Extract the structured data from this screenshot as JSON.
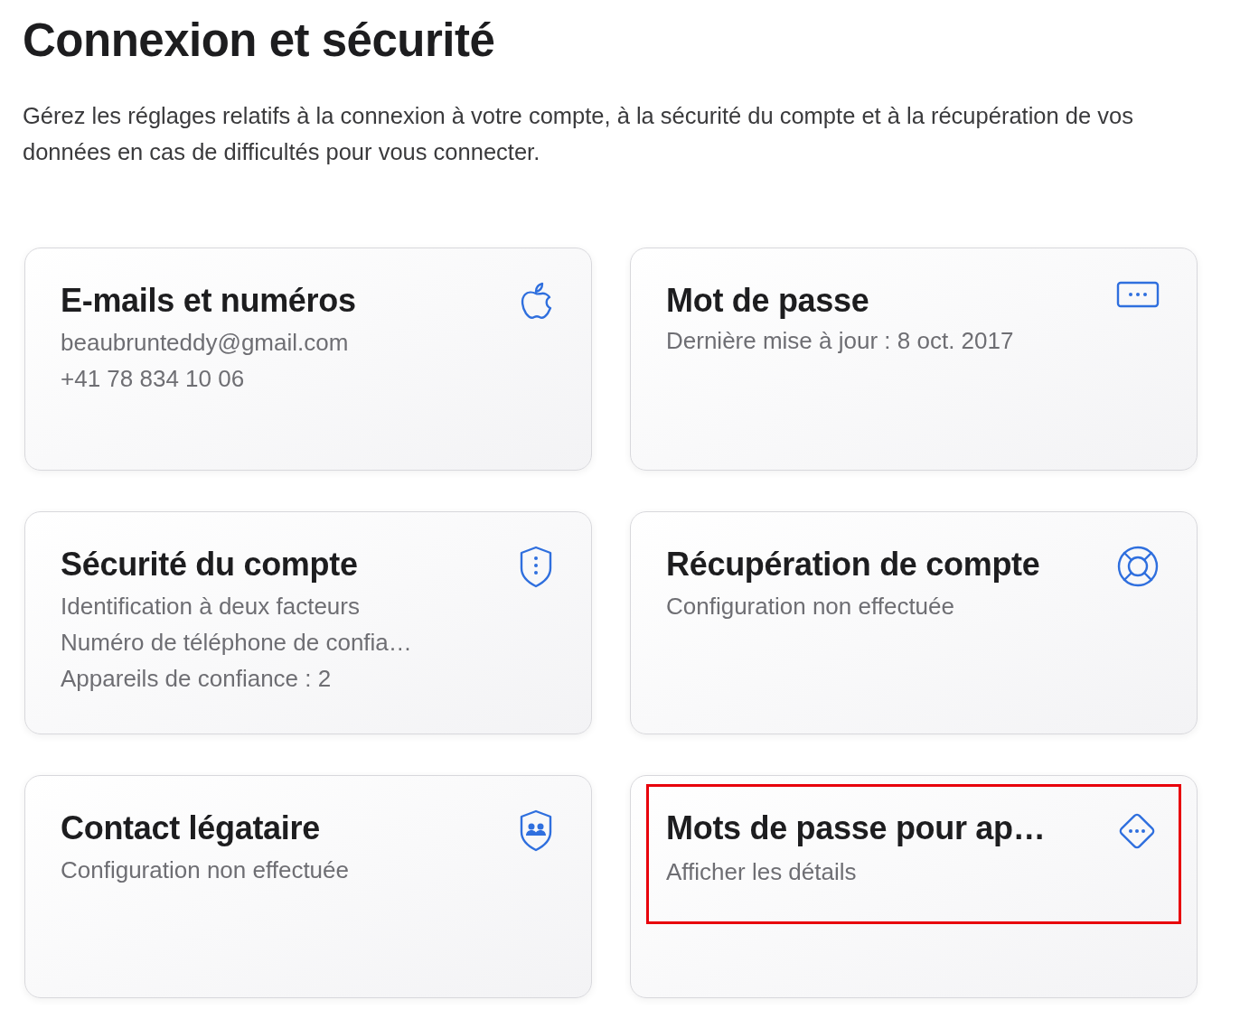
{
  "title": "Connexion et sécurité",
  "description": "Gérez les réglages relatifs à la connexion à votre compte, à la sécurité du compte et à la récupération de vos données en cas de difficultés pour vous connecter.",
  "cards": [
    {
      "title": "E-mails et numéros",
      "lines": [
        "beaubrunteddy@gmail.com",
        "+41 78 834 10 06"
      ],
      "highlighted": false
    },
    {
      "title": "Mot de passe",
      "lines": [
        "Dernière mise à jour : 8 oct. 2017"
      ],
      "highlighted": false
    },
    {
      "title": "Sécurité du compte",
      "lines": [
        "Identification à deux facteurs",
        "Numéro de téléphone de confia…",
        "Appareils de confiance : 2"
      ],
      "highlighted": false
    },
    {
      "title": "Récupération de compte",
      "lines": [
        "Configuration non effectuée"
      ],
      "highlighted": false
    },
    {
      "title": "Contact légataire",
      "lines": [
        "Configuration non effectuée"
      ],
      "highlighted": false
    },
    {
      "title": "Mots de passe pour ap…",
      "lines": [
        "Afficher les détails"
      ],
      "highlighted": true
    }
  ]
}
